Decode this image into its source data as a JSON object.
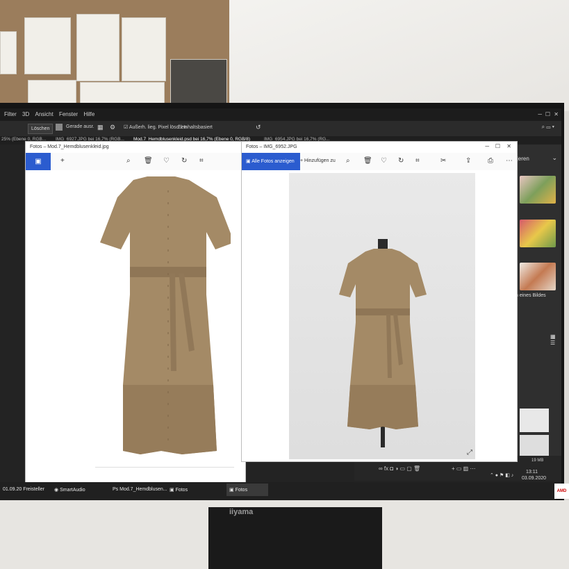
{
  "photoshop": {
    "menu": [
      "Filter",
      "3D",
      "Ansicht",
      "Fenster",
      "Hilfe"
    ],
    "options": {
      "delete_label": "Löschen",
      "straighten_label": "Gerade ausr.",
      "checkbox1_label": "Außerh. lieg. Pixel löschen",
      "checkbox2_label": "Inhaltsbasiert"
    },
    "doc_tabs": [
      "25% (Ebene 0, RGB...",
      "IMG_6927.JPG bei 16,7% (RGB...",
      "Mod.7_Hemdblusenkleid.psd bei 16,7% (Ebene 0, RGB/8)",
      "IMG_6954.JPG bei 16,7% (RG..."
    ],
    "right_panel_text": "jeren",
    "right_panel_text2": "n eines Bildes",
    "status_size": "19 MB"
  },
  "window_left": {
    "title": "Fotos – Mod.7_Hemdblusenkleid.jpg"
  },
  "window_right": {
    "title": "Fotos – IMG_6952.JPG",
    "show_all_label": "Alle Fotos anzeigen",
    "add_label": "Hinzufügen zu"
  },
  "taskbar": {
    "date_left": "01.09.20 Freisteller",
    "items": [
      "SmartAudio",
      "Mod.7_Hemdblusen...",
      "Fotos",
      "Fotos"
    ],
    "clock_time": "13:11",
    "clock_date": "03.09.2020"
  },
  "monitor_brand": "iiyama",
  "sticker": "AMD",
  "colors": {
    "accent": "#2b5ccf",
    "dress": "#a48a66",
    "ps_dark": "#232323"
  }
}
